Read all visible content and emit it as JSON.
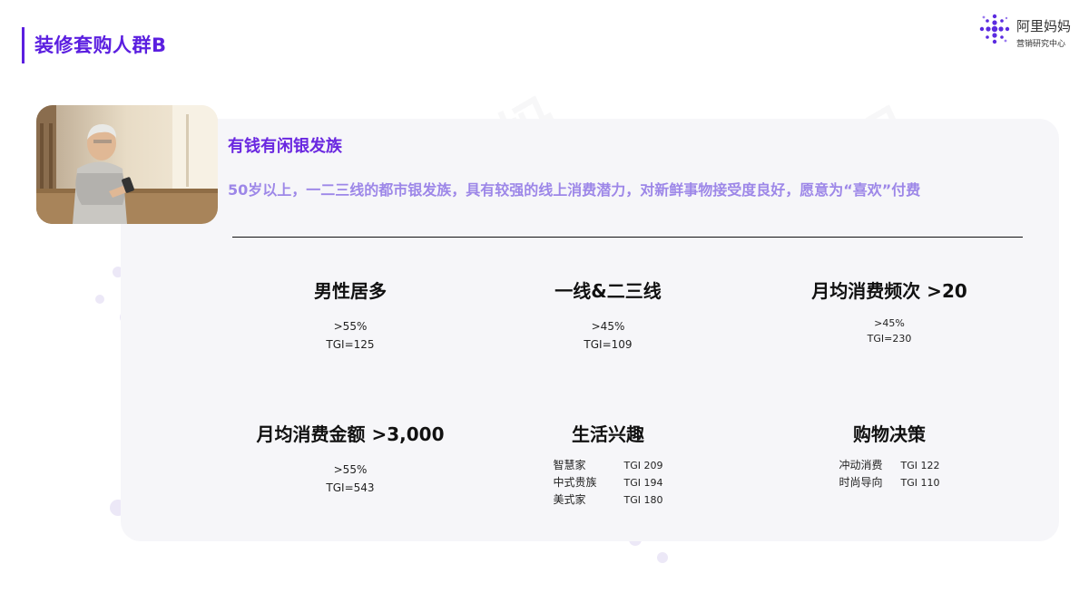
{
  "header": {
    "title": "装修套购人群B",
    "accent_color": "#5b1fe0"
  },
  "logo": {
    "name": "阿里妈妈",
    "subtitle": "营销研究中心",
    "icon": "dots-cluster-logo"
  },
  "persona": {
    "image": "elderly-man-using-phone-photo",
    "title": "有钱有闲银发族",
    "description": "50岁以上，一二三线的都市银发族，具有较强的线上消费潜力，对新鲜事物接受度良好，愿意为“喜欢”付费"
  },
  "stats": [
    {
      "heading": "男性居多",
      "lines": [
        ">55%",
        "TGI=125"
      ]
    },
    {
      "heading": "一线&二三线",
      "lines": [
        ">45%",
        "TGI=109"
      ]
    },
    {
      "heading": "月均消费频次 >20",
      "lines": [
        ">45%",
        "TGI=230"
      ]
    },
    {
      "heading": "月均消费金额 >3,000",
      "lines": [
        ">55%",
        "TGI=543"
      ]
    }
  ],
  "interests": {
    "heading": "生活兴趣",
    "rows": [
      {
        "label": "智慧家",
        "value": "TGI 209"
      },
      {
        "label": "中式贵族",
        "value": "TGI 194"
      },
      {
        "label": "美式家",
        "value": "TGI 180"
      }
    ]
  },
  "decision": {
    "heading": "购物决策",
    "rows": [
      {
        "label": "冲动消费",
        "value": "TGI 122"
      },
      {
        "label": "时尚导向",
        "value": "TGI 110"
      }
    ]
  },
  "watermark_text": "阿里妈妈",
  "colors": {
    "primary": "#5b1fe0",
    "persona_title": "#6a28e0",
    "persona_desc": "#9d87e8",
    "panel_bg": "#f6f6f9"
  }
}
